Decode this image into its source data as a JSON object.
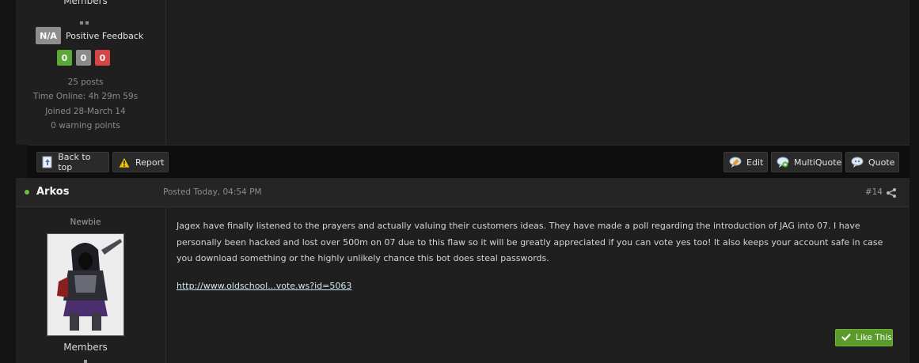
{
  "previous_post": {
    "group": "Members",
    "feedback_badge": "N/A",
    "feedback_label": "Positive Feedback",
    "feedback_counts": {
      "positive": "0",
      "neutral": "0",
      "negative": "0"
    },
    "stats": {
      "posts": "25 posts",
      "time_online": "Time Online: 4h 29m 59s",
      "joined": "Joined 28-March 14",
      "warning": "0 warning points"
    }
  },
  "action_bar": {
    "back_to_top": "Back to top",
    "report": "Report",
    "edit": "Edit",
    "multiquote": "MultiQuote",
    "quote": "Quote"
  },
  "post": {
    "author": "Arkos",
    "posted": "Posted Today, 04:54 PM",
    "number": "#14",
    "rank": "Newbie",
    "group": "Members",
    "content": "Jagex have finally listened to the prayers and actually valuing their customers ideas. They have made a poll regarding the introduction of JAG into 07. I have personally been hacked and lost over 500m on 07 due to this flaw so it will be greatly appreciated if you can vote yes too! It also keeps your account safe in case you download something or the highly unlikely chance this bot does steal passwords.",
    "link": "http://www.oldschool...vote.ws?id=5063",
    "like_label": "Like This"
  },
  "colors": {
    "online": "#6fbf3a",
    "positive": "#5aa937",
    "neutral": "#8b8b8b",
    "negative": "#d64545",
    "like": "#5a9b2a"
  }
}
